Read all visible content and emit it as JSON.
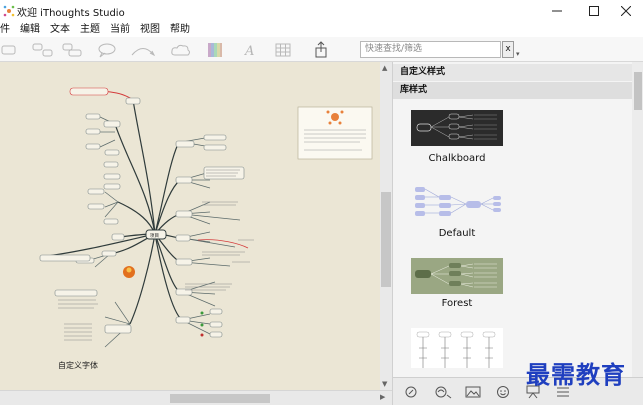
{
  "window": {
    "title": "欢迎 iThoughts Studio"
  },
  "menu": {
    "items": [
      "件",
      "编辑",
      "文本",
      "主题",
      "当前",
      "视图",
      "帮助"
    ]
  },
  "toolbar": {
    "search_placeholder": "快速查找/筛选",
    "clear_label": "x"
  },
  "panel": {
    "custom_styles_label": "自定义样式",
    "library_styles_label": "库样式",
    "styles": [
      {
        "name": "Chalkboard"
      },
      {
        "name": "Default"
      },
      {
        "name": "Forest"
      }
    ]
  },
  "canvas": {
    "custom_font_label": "自定义字体",
    "center_topic": "项目"
  },
  "watermark": {
    "text": "最需教育"
  }
}
